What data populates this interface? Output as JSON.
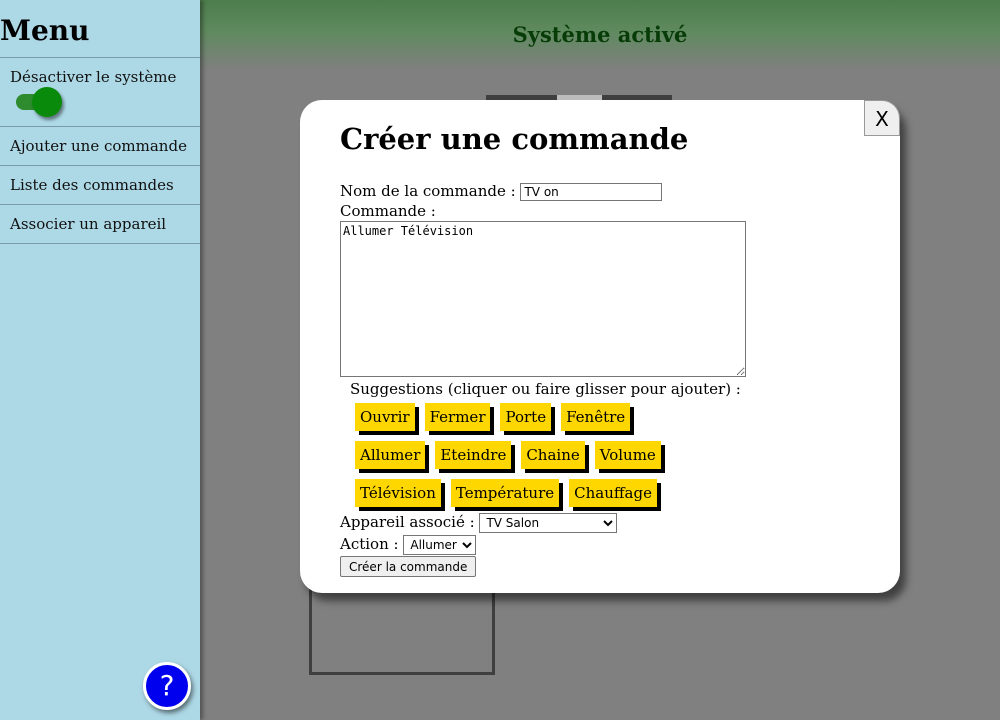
{
  "sidebar": {
    "title": "Menu",
    "toggle_label": "Désactiver le système",
    "toggle_on": true,
    "items": [
      {
        "label": "Ajouter une commande"
      },
      {
        "label": "Liste des commandes"
      },
      {
        "label": "Associer un appareil"
      }
    ],
    "help_label": "?"
  },
  "header": {
    "title": "Système activé"
  },
  "modal": {
    "close_label": "X",
    "title": "Créer une commande",
    "name_label": "Nom de la commande :",
    "name_value": "TV on",
    "command_label": "Commande :",
    "command_value": "Allumer Télévision",
    "suggestions_label": "Suggestions (cliquer ou faire glisser pour ajouter) :",
    "suggestions": [
      [
        "Ouvrir",
        "Fermer",
        "Porte",
        "Fenêtre"
      ],
      [
        "Allumer",
        "Eteindre",
        "Chaine",
        "Volume"
      ],
      [
        "Télévision",
        "Température",
        "Chauffage"
      ]
    ],
    "device_label": "Appareil associé :",
    "device_selected": "TV Salon",
    "action_label": "Action :",
    "action_selected": "Allumer",
    "submit_label": "Créer la commande"
  },
  "colors": {
    "sidebar_bg": "#add8e6",
    "header_green": "#4d7d4d",
    "chip_bg": "#ffd700",
    "help_bg": "#0000ee"
  }
}
